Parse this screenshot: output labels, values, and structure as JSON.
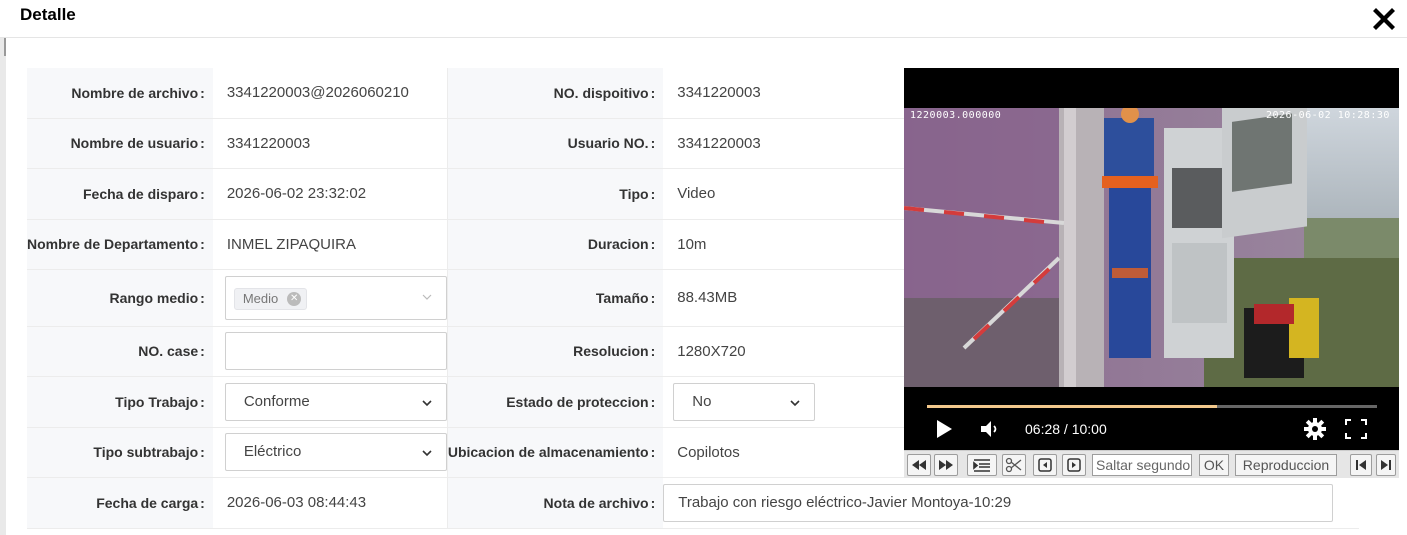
{
  "dialog": {
    "title": "Detalle"
  },
  "fields": {
    "file_name": {
      "label": "Nombre de archivo",
      "value": "3341220003@2026060210"
    },
    "device_no": {
      "label": "NO. dispoitivo",
      "value": "3341220003"
    },
    "user_name": {
      "label": "Nombre de usuario",
      "value": "3341220003"
    },
    "user_no": {
      "label": "Usuario NO.",
      "value": "3341220003"
    },
    "trigger_date": {
      "label": "Fecha de disparo",
      "value": "2026-06-02 23:32:02"
    },
    "type": {
      "label": "Tipo",
      "value": "Video"
    },
    "department": {
      "label": "Nombre de Departamento",
      "value": "INMEL ZIPAQUIRA"
    },
    "duration": {
      "label": "Duracion",
      "value": "10m"
    },
    "range": {
      "label": "Rango medio",
      "tag": "Medio"
    },
    "size": {
      "label": "Tamaño",
      "value": "88.43MB"
    },
    "case_no": {
      "label": "NO. case",
      "value": ""
    },
    "resolution": {
      "label": "Resolucion",
      "value": "1280X720"
    },
    "work_type": {
      "label": "Tipo Trabajo",
      "value": "Conforme"
    },
    "protection": {
      "label": "Estado de proteccion",
      "value": "No"
    },
    "subwork_type": {
      "label": "Tipo subtrabajo",
      "value": "Eléctrico"
    },
    "storage": {
      "label": "Ubicacion de almacenamiento",
      "value": "Copilotos"
    },
    "upload_date": {
      "label": "Fecha de carga",
      "value": "2026-06-03 08:44:43"
    },
    "note": {
      "label": "Nota de archivo",
      "value": "Trabajo con riesgo eléctrico-Javier Montoya-10:29"
    }
  },
  "colon": ":",
  "video": {
    "osd_left": "1220003.000000",
    "osd_right": "2026-06-02  10:28:30",
    "time": "06:28 / 10:00",
    "progress": 0.645
  },
  "toolbar": {
    "seek_placeholder": "Saltar segundo",
    "ok_label": "OK",
    "playback_label": "Reproduccion"
  }
}
